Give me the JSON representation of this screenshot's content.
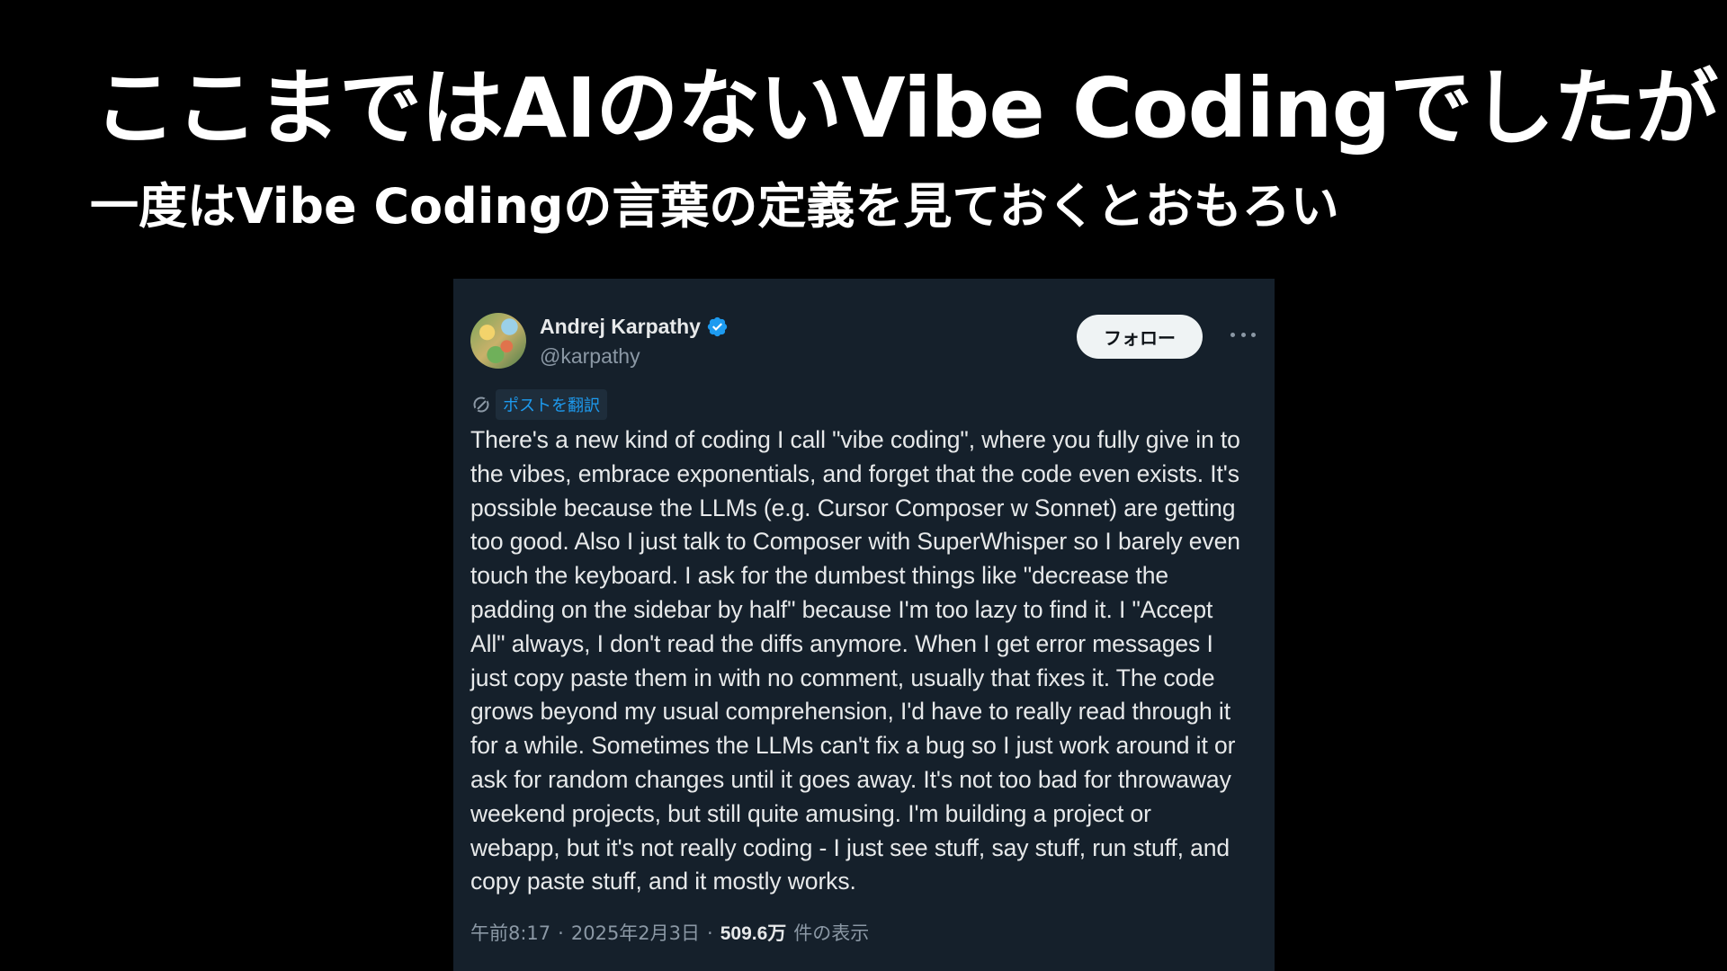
{
  "slide": {
    "title": "ここまではAIのないVibe Codingでしたが",
    "subtitle": "一度はVibe Codingの言葉の定義を見ておくとおもろい"
  },
  "tweet": {
    "author_name": "Andrej Karpathy",
    "author_handle": "@karpathy",
    "verified_icon": "verified-badge-icon",
    "follow_label": "フォロー",
    "more_icon": "more-horizontal-icon",
    "translate_label": "ポストを翻訳",
    "translate_icon": "translate-icon",
    "text_lines": [
      "There's a new kind of coding I call \"vibe coding\", where you fully give in to",
      "the vibes, embrace exponentials, and forget that the code even exists. It's",
      "possible because the LLMs (e.g. Cursor Composer w Sonnet) are getting",
      "too good. Also I just talk to Composer with SuperWhisper so I barely even",
      "touch the keyboard. I ask for the dumbest things like \"decrease the",
      "padding on the sidebar by half\" because I'm too lazy to find it. I \"Accept",
      "All\" always, I don't read the diffs anymore. When I get error messages I",
      "just copy paste them in with no comment, usually that fixes it. The code",
      "grows beyond my usual comprehension, I'd have to really read through it",
      "for a while. Sometimes the LLMs can't fix a bug so I just work around it or",
      "ask for random changes until it goes away. It's not too bad for throwaway",
      "weekend projects, but still quite amusing. I'm building a project or",
      "webapp, but it's not really coding - I just see stuff, say stuff, run stuff, and",
      "copy paste stuff, and it mostly works."
    ],
    "time": "午前8:17",
    "separator": "·",
    "date": "2025年2月3日",
    "views_count": "509.6万",
    "views_label": "件の表示"
  },
  "colors": {
    "background": "#000000",
    "card": "#15202b",
    "accent": "#1d9bf0",
    "text": "#e7e9ea",
    "muted": "#8b98a5"
  }
}
